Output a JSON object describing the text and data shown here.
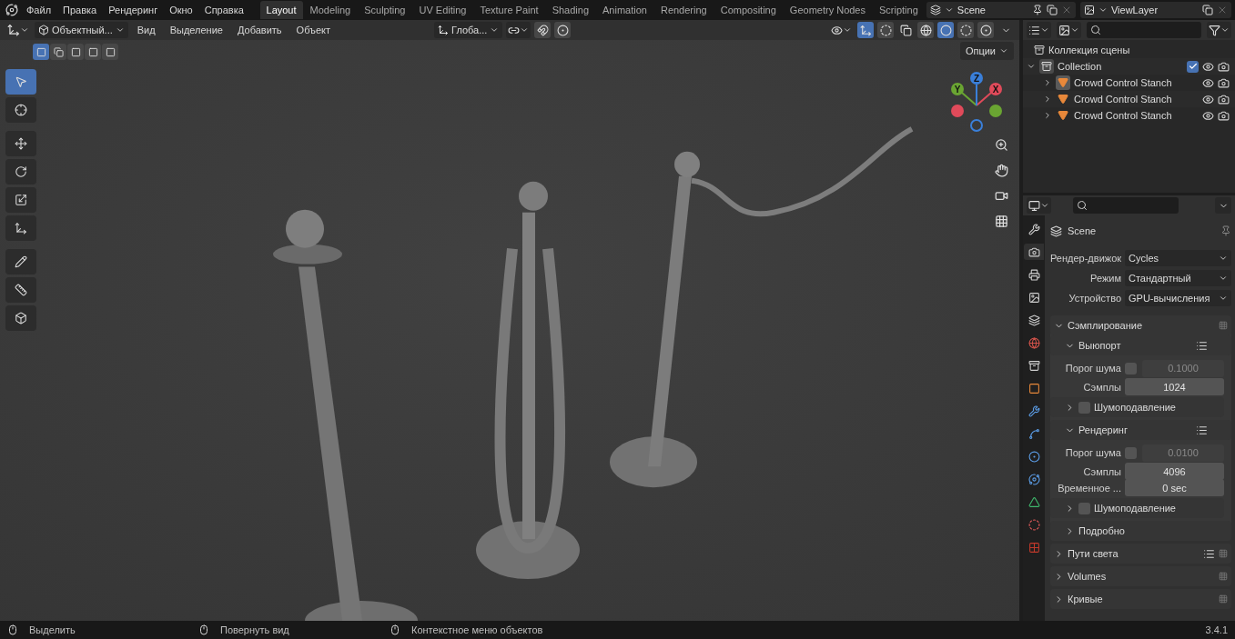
{
  "top_bar": {
    "menus": [
      "Файл",
      "Правка",
      "Рендеринг",
      "Окно",
      "Справка"
    ],
    "workspaces": [
      {
        "label": "Layout",
        "selected": true
      },
      {
        "label": "Modeling",
        "selected": false
      },
      {
        "label": "Sculpting",
        "selected": false
      },
      {
        "label": "UV Editing",
        "selected": false
      },
      {
        "label": "Texture Paint",
        "selected": false
      },
      {
        "label": "Shading",
        "selected": false
      },
      {
        "label": "Animation",
        "selected": false
      },
      {
        "label": "Rendering",
        "selected": false
      },
      {
        "label": "Compositing",
        "selected": false
      },
      {
        "label": "Geometry Nodes",
        "selected": false
      },
      {
        "label": "Scripting",
        "selected": false
      }
    ],
    "scene": "Scene",
    "view_layer": "ViewLayer"
  },
  "viewport": {
    "mode": "Объектный...",
    "menus": [
      "Вид",
      "Выделение",
      "Добавить",
      "Объект"
    ],
    "orientation": "Глоба...",
    "shading": [
      {
        "selected": false
      },
      {
        "selected": true
      },
      {
        "selected": false
      },
      {
        "selected": false
      }
    ],
    "select_modes": [
      {
        "selected": true
      },
      {
        "selected": false
      },
      {
        "selected": false
      },
      {
        "selected": false
      },
      {
        "selected": false
      }
    ],
    "options": "Опции",
    "tools": [
      {
        "selected": true
      },
      {
        "selected": false
      },
      {
        "selected": false
      },
      {
        "selected": false
      },
      {
        "selected": false
      },
      {
        "selected": false
      },
      {
        "selected": false
      },
      {
        "selected": false
      },
      {
        "selected": false
      }
    ],
    "gizmo_axes": [
      "X",
      "Y",
      "Z"
    ]
  },
  "outliner": {
    "scene_collection": "Коллекция сцены",
    "collection": {
      "name": "Collection",
      "expanded": true,
      "checked": true,
      "children": [
        {
          "name": "Crowd Control Stanch",
          "selected": true
        },
        {
          "name": "Crowd Control Stanch",
          "selected": false
        },
        {
          "name": "Crowd Control Stanch",
          "selected": false
        }
      ]
    }
  },
  "properties": {
    "tabs": [
      {
        "selected": false
      },
      {
        "selected": true
      },
      {
        "selected": false
      },
      {
        "selected": false
      },
      {
        "selected": false
      },
      {
        "selected": false
      },
      {
        "selected": false
      },
      {
        "selected": false
      },
      {
        "selected": false
      },
      {
        "selected": false
      },
      {
        "selected": false
      },
      {
        "selected": false
      },
      {
        "selected": false
      },
      {
        "selected": false
      },
      {
        "selected": false
      }
    ],
    "context": "Scene",
    "fields": [
      {
        "label": "Рендер-движок",
        "value": "Cycles"
      },
      {
        "label": "Режим",
        "value": "Стандартный"
      },
      {
        "label": "Устройство",
        "value": "GPU-вычисления"
      }
    ],
    "panels": [
      {
        "title": "Сэмплирование",
        "expanded": true,
        "subpanels": [
          {
            "title": "Выюпорт",
            "expanded": true,
            "presets": true,
            "rows": [
              {
                "kind": "threshold",
                "label": "Порог шума",
                "checked": false,
                "value": "0.1000"
              },
              {
                "kind": "number",
                "label": "Сэмплы",
                "value": "1024"
              }
            ],
            "children": [
              {
                "title": "Шумоподавление",
                "expanded": false,
                "checked": false
              }
            ]
          },
          {
            "title": "Рендеринг",
            "expanded": true,
            "presets": true,
            "rows": [
              {
                "kind": "threshold",
                "label": "Порог шума",
                "checked": false,
                "value": "0.0100"
              },
              {
                "kind": "number",
                "label": "Сэмплы",
                "value": "4096"
              },
              {
                "kind": "number",
                "label": "Временное ...",
                "value": "0 sec"
              }
            ],
            "children": [
              {
                "title": "Шумоподавление",
                "expanded": false,
                "checked": false
              }
            ]
          },
          {
            "title": "Подробно",
            "expanded": false
          }
        ]
      },
      {
        "title": "Пути света",
        "expanded": false,
        "presets": true
      },
      {
        "title": "Volumes",
        "expanded": false
      },
      {
        "title": "Кривые",
        "expanded": false
      }
    ]
  },
  "status_bar": {
    "items": [
      "Выделить",
      "Повернуть вид",
      "Контекстное меню объектов"
    ],
    "version": "3.4.1"
  }
}
